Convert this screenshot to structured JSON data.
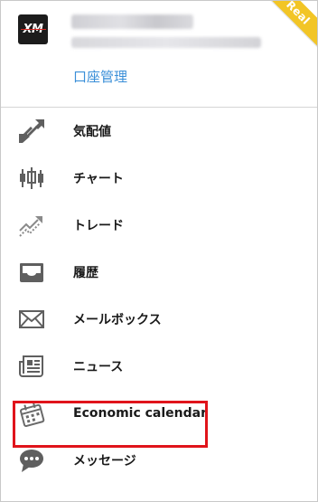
{
  "header": {
    "logo_text": "XM",
    "account_manage_label": "口座管理",
    "badge_label": "Real",
    "badge_color": "#f2c526",
    "link_color": "#3a8fd8"
  },
  "menu": {
    "items": [
      {
        "id": "quotes",
        "label": "気配値",
        "icon": "arrows-diagonal-icon"
      },
      {
        "id": "chart",
        "label": "チャート",
        "icon": "candlestick-icon"
      },
      {
        "id": "trade",
        "label": "トレード",
        "icon": "trend-up-icon"
      },
      {
        "id": "history",
        "label": "履歴",
        "icon": "inbox-tray-icon"
      },
      {
        "id": "mailbox",
        "label": "メールボックス",
        "icon": "envelope-icon"
      },
      {
        "id": "news",
        "label": "ニュース",
        "icon": "newspaper-icon"
      },
      {
        "id": "calendar",
        "label": "Economic calendar",
        "icon": "calendar-icon",
        "highlighted": true
      },
      {
        "id": "messages",
        "label": "メッセージ",
        "icon": "chat-bubble-icon"
      }
    ]
  },
  "highlight_color": "#e0141b"
}
